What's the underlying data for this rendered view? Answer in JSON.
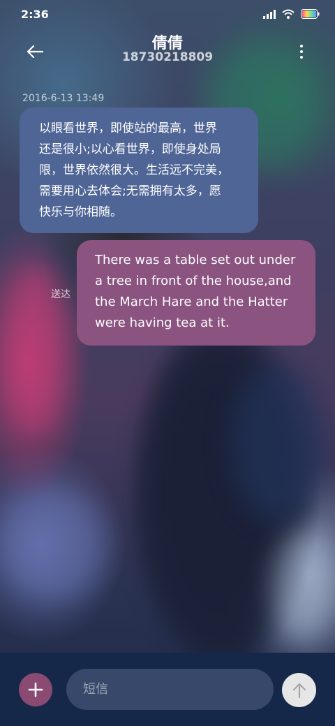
{
  "status_bar": {
    "time": "2:36",
    "icons": [
      "signal-icon",
      "wifi-icon",
      "battery-icon"
    ]
  },
  "header": {
    "contact_name": "倩倩",
    "contact_number": "18730218809",
    "back_icon": "back-arrow-icon",
    "menu_icon": "more-vertical-icon"
  },
  "conversation": {
    "timestamp": "2016-6-13 13:49",
    "messages": [
      {
        "direction": "incoming",
        "text": "以眼看世界，即使站的最高，世界\n还是很小;以心看世界，即使身处局\n限，世界依然很大。生活远不完美，\n需要用心去体会;无需拥有太多，愿\n快乐与你相随。"
      },
      {
        "direction": "outgoing",
        "text": "There was a table set out under\na tree in front of the house,and\nthe March Hare and the Hatter\nwere having tea at it.",
        "status": "送达"
      }
    ]
  },
  "composer": {
    "placeholder": "短信",
    "value": "",
    "add_icon": "plus-icon",
    "send_icon": "arrow-up-icon"
  },
  "colors": {
    "incoming_bubble": "#4f6596",
    "outgoing_bubble": "#8b5380",
    "composer_bg": "#16284a",
    "add_button": "#8a4a72",
    "send_button": "#e6e6e6"
  }
}
